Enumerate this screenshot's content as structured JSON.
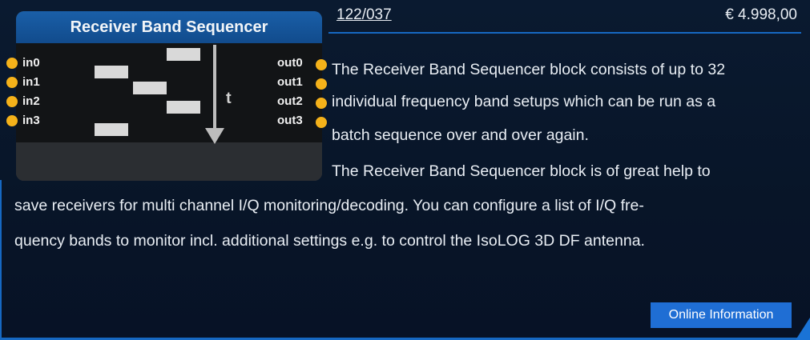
{
  "product": {
    "article_number": "122/037",
    "price": "€ 4.998,00"
  },
  "block": {
    "title": "Receiver Band Sequencer",
    "inputs": [
      "in0",
      "in1",
      "in2",
      "in3"
    ],
    "outputs": [
      "out0",
      "out1",
      "out2",
      "out3"
    ],
    "time_label": "t",
    "port_color": "#f5b21a",
    "header_color": "#1a5fa8"
  },
  "description": {
    "lines": [
      "The Receiver Band Sequencer block consists of up to 32",
      "individual frequency band setups which can be run as a",
      "batch sequence over and over again.",
      "The Receiver Band Sequencer block is of great help to",
      "save receivers for multi channel I/Q monitoring/decoding. You can configure a list of I/Q fre-",
      "quency bands to monitor incl. additional settings e.g. to control the IsoLOG 3D DF antenna."
    ]
  },
  "actions": {
    "online_info_label": "Online Information",
    "accent_color": "#1f6ed4"
  }
}
